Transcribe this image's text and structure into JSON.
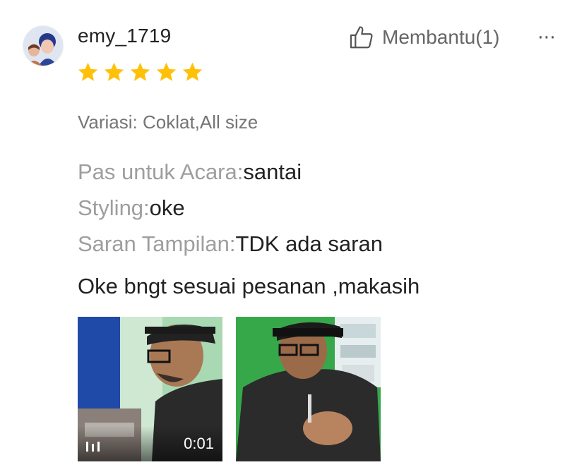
{
  "review": {
    "username": "emy_1719",
    "rating": 5,
    "rating_max": 5,
    "helpful_label": "Membantu(1)",
    "more_icon": "more-dots-icon",
    "variation": "Variasi: Coklat,All size",
    "attributes": [
      {
        "key": "Pas untuk Acara:",
        "value": "santai"
      },
      {
        "key": "Styling:",
        "value": "oke"
      },
      {
        "key": "Saran Tampilan:",
        "value": "TDK ada saran"
      }
    ],
    "comment": "Oke bngt sesuai pesanan ,makasih",
    "media": [
      {
        "type": "video",
        "duration": "0:01"
      },
      {
        "type": "image"
      }
    ]
  },
  "colors": {
    "star": "#FFC107",
    "text_primary": "#222222",
    "text_secondary": "#757575",
    "text_label": "#9E9E9E"
  },
  "icons": {
    "thumbs_up": "thumbs-up-icon",
    "star": "star-icon",
    "video": "video-icon"
  }
}
